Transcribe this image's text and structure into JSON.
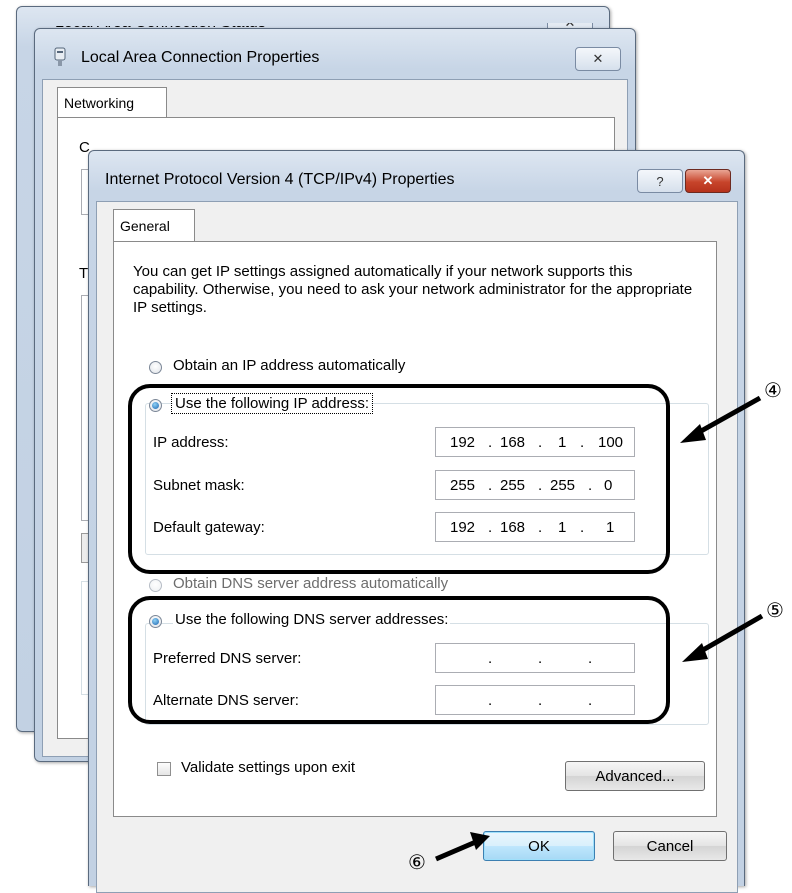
{
  "back_window": {
    "title": "Local Area Connection Status",
    "close_glyph": "✕"
  },
  "mid_window": {
    "title": "Local Area Connection Properties",
    "close_glyph": "✕",
    "tab": "Networking",
    "partial_labels": [
      "C",
      "T"
    ]
  },
  "dialog": {
    "title": "Internet Protocol Version 4 (TCP/IPv4) Properties",
    "help_glyph": "?",
    "close_glyph": "✕",
    "tab": "General",
    "description": "You can get IP settings assigned automatically if your network supports this capability. Otherwise, you need to ask your network administrator for the appropriate IP settings.",
    "ip_auto_label": "Obtain an IP address automatically",
    "ip_manual_label": "Use the following IP address:",
    "ip_address_label": "IP address:",
    "ip_address_value": [
      "192",
      "168",
      "1",
      "100"
    ],
    "subnet_label": "Subnet mask:",
    "subnet_value": [
      "255",
      "255",
      "255",
      "0"
    ],
    "gateway_label": "Default gateway:",
    "gateway_value": [
      "192",
      "168",
      "1",
      "1"
    ],
    "dns_auto_label": "Obtain DNS server address automatically",
    "dns_manual_label": "Use the following DNS server addresses:",
    "preferred_dns_label": "Preferred DNS server:",
    "preferred_dns_value": [
      "",
      "",
      "",
      ""
    ],
    "alternate_dns_label": "Alternate DNS server:",
    "alternate_dns_value": [
      "",
      "",
      "",
      ""
    ],
    "validate_label": "Validate settings upon exit",
    "advanced_button": "Advanced...",
    "ok_button": "OK",
    "cancel_button": "Cancel",
    "ip_mode": "manual",
    "dns_mode": "manual",
    "validate_checked": false
  },
  "annotations": {
    "step4": "④",
    "step5": "⑤",
    "step6": "⑥"
  },
  "colors": {
    "close_red": "#c7442b",
    "selection_blue": "#1a64b0",
    "highlight_outline": "#000000"
  }
}
